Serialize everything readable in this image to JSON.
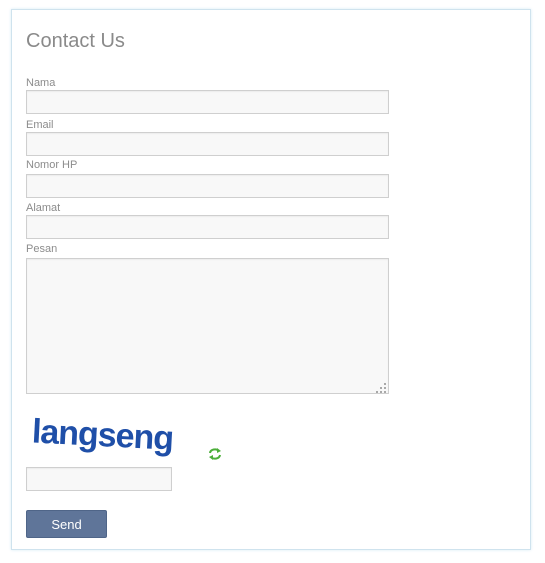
{
  "form": {
    "title": "Contact Us",
    "fields": [
      {
        "label": "Nama",
        "value": ""
      },
      {
        "label": "Email",
        "value": ""
      },
      {
        "label": "Nomor HP",
        "value": ""
      },
      {
        "label": "Alamat",
        "value": ""
      },
      {
        "label": "Pesan",
        "value": ""
      }
    ],
    "captcha": {
      "text": "langseng",
      "input_value": ""
    },
    "icons": {
      "refresh": "refresh-icon",
      "resize": "resize-grip-icon"
    },
    "colors": {
      "button": "#5f7599",
      "captcha_text": "#1f4fa8",
      "refresh_icon": "#4cae3a"
    },
    "send_label": "Send"
  }
}
